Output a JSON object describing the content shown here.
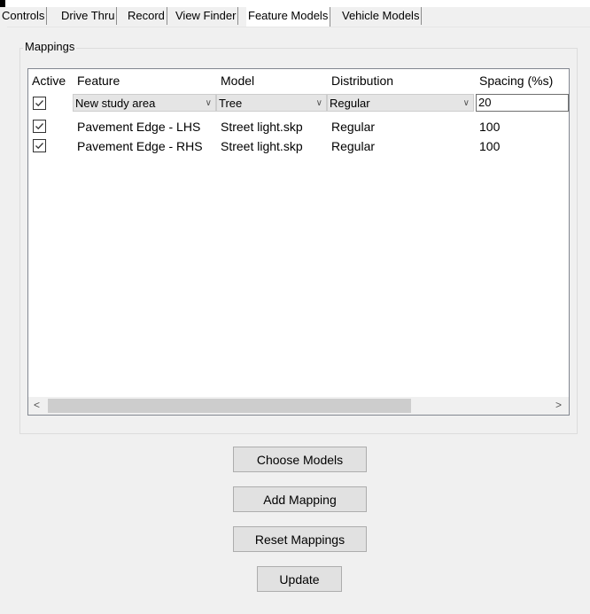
{
  "tabs": [
    "Controls",
    "Drive Thru",
    "Record",
    "View Finder",
    "Feature Models",
    "Vehicle Models"
  ],
  "active_tab": "Feature Models",
  "group_title": "Mappings",
  "columns": [
    "Active",
    "Feature",
    "Model",
    "Distribution",
    "Spacing (%s)"
  ],
  "edit_row": {
    "active": true,
    "feature": "New study area",
    "model": "Tree",
    "distribution": "Regular",
    "spacing": "20"
  },
  "rows": [
    {
      "active": true,
      "feature": "Pavement Edge - LHS",
      "model": "Street light.skp",
      "distribution": "Regular",
      "spacing": "100"
    },
    {
      "active": true,
      "feature": "Pavement Edge - RHS",
      "model": "Street light.skp",
      "distribution": "Regular",
      "spacing": "100"
    }
  ],
  "buttons": {
    "choose_models": "Choose Models",
    "add_mapping": "Add Mapping",
    "reset_mappings": "Reset Mappings",
    "update": "Update"
  }
}
